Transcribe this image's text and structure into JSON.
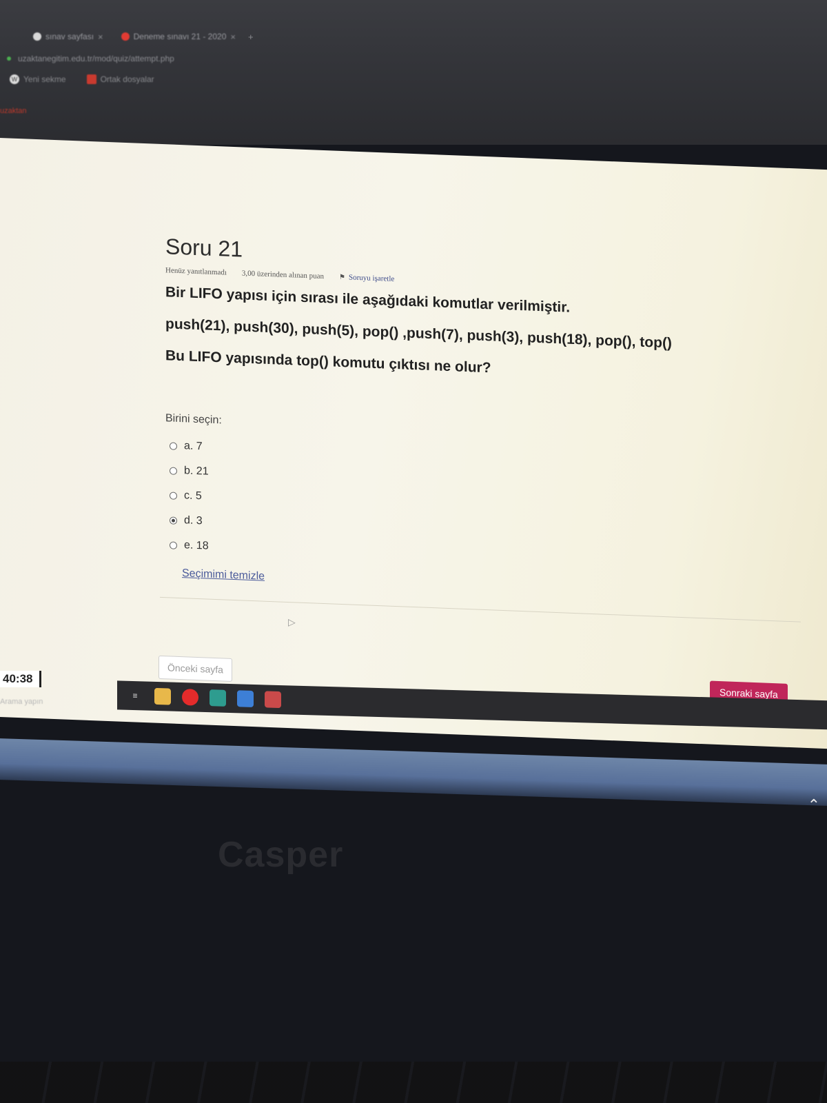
{
  "browser": {
    "tabs": [
      {
        "title": "sınav sayfası",
        "icon": "circle-icon"
      },
      {
        "title": "Deneme sınavı 21 - 2020",
        "icon": "youtube-icon"
      }
    ],
    "tab_close": "×",
    "new_tab": "+",
    "address": "uzaktanegitim.edu.tr/mod/quiz/attempt.php",
    "bookmarks": [
      {
        "label": "Yeni sekme",
        "icon": "w-icon"
      },
      {
        "label": "Ortak dosyalar",
        "icon": "red-bookmark-icon"
      }
    ],
    "site_tag": "uzaktan"
  },
  "question": {
    "title": "Soru 21",
    "status": "Henüz yanıtlanmadı",
    "points": "3,00 üzerinden alınan puan",
    "flag_label": "Soruyu işaretle",
    "text_line1": "Bir LIFO yapısı için sırası ile aşağıdaki komutlar verilmiştir.",
    "text_line2": "push(21), push(30), push(5), pop() ,push(7), push(3), push(18), pop(),  top()",
    "text_line3": "Bu LIFO yapısında top() komutu çıktısı ne olur?",
    "prompt": "Birini seçin:",
    "options": [
      {
        "label": "a. 7",
        "selected": false
      },
      {
        "label": "b. 21",
        "selected": false
      },
      {
        "label": "c. 5",
        "selected": false
      },
      {
        "label": "d. 3",
        "selected": true
      },
      {
        "label": "e. 18",
        "selected": false
      }
    ],
    "clear_label": "Seçimimi temizle"
  },
  "nav": {
    "prev_label": "Önceki sayfa",
    "next_label": "Sonraki sayfa",
    "next_color": "#c0265a"
  },
  "timer": "40:38",
  "search_hint": "Arama yapın",
  "taskbar": {
    "icons": [
      "task-view-icon",
      "folder-icon",
      "opera-icon",
      "app-icon",
      "blue-app-icon",
      "red-app-icon"
    ]
  },
  "laptop": {
    "brand": "Casper"
  }
}
